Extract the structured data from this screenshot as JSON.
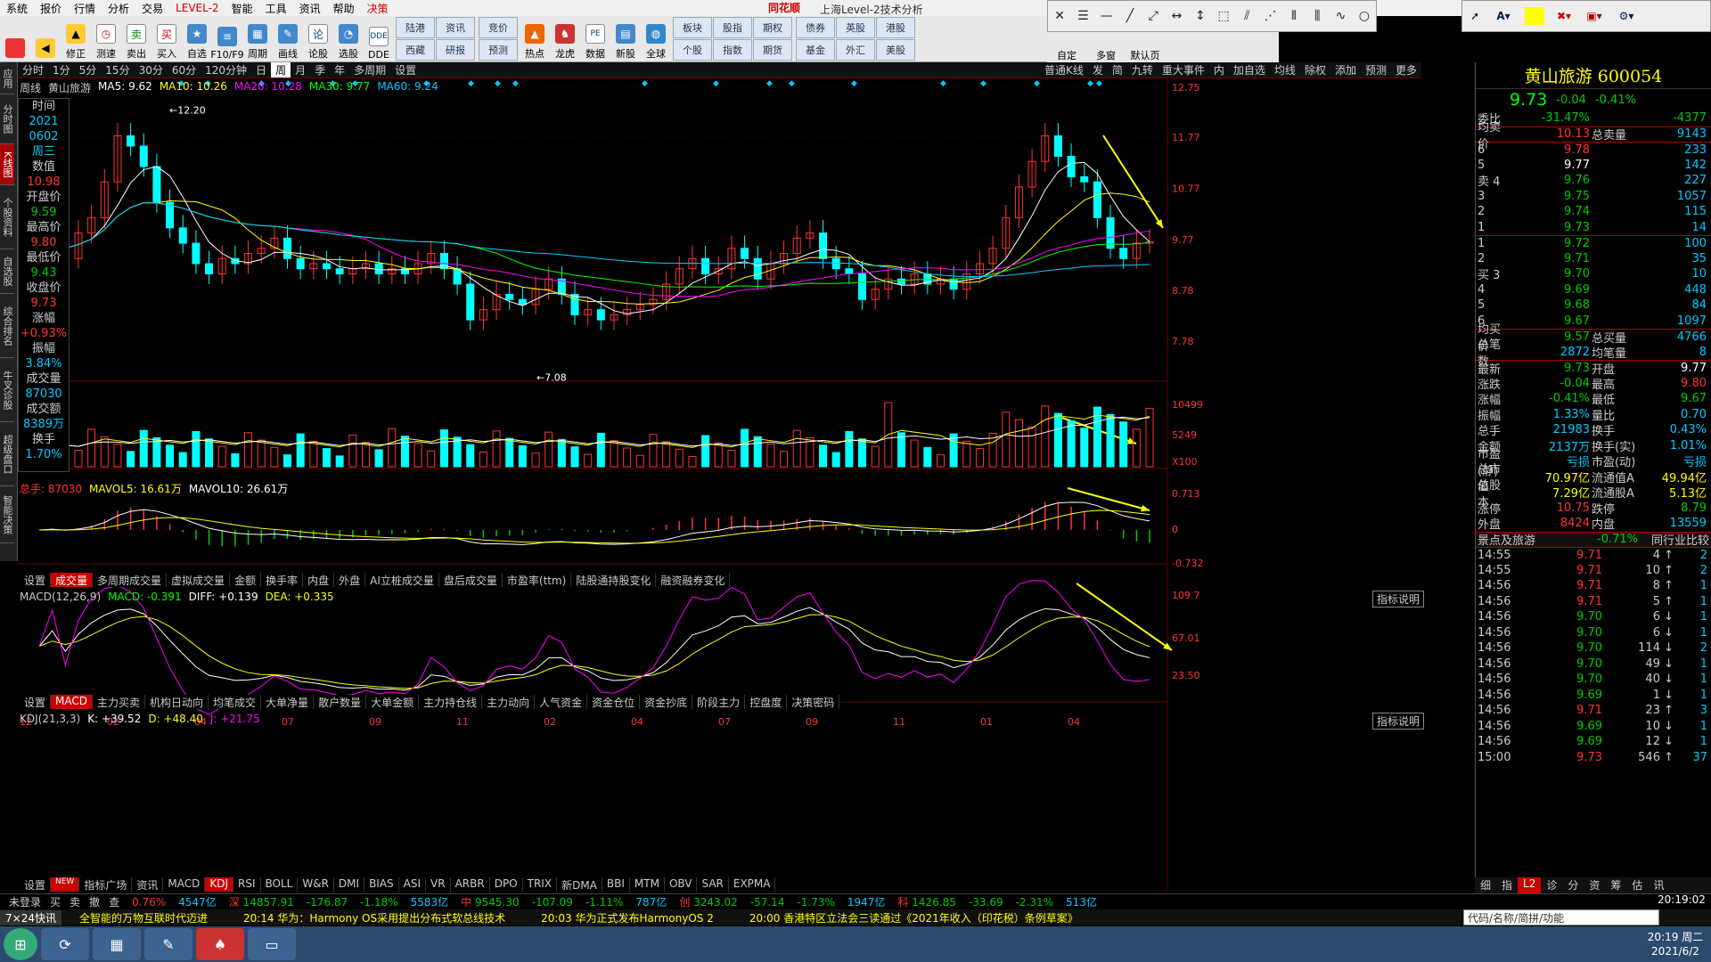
{
  "menubar": {
    "items": [
      "系统",
      "报价",
      "行情",
      "分析",
      "交易",
      "LEVEL-2",
      "智能",
      "工具",
      "资讯",
      "帮助",
      "决策"
    ],
    "brand": "同花顺",
    "title": "上海Level-2技术分析"
  },
  "toolbar": {
    "buttons": [
      [
        "后退"
      ],
      [
        "修正"
      ],
      [
        "测速"
      ],
      [
        "卖出"
      ],
      [
        "买入"
      ],
      [
        "自选"
      ],
      [
        "F10/F9"
      ],
      [
        "周期"
      ],
      [
        "画线"
      ],
      [
        "论股"
      ],
      [
        "选股"
      ],
      [
        "DDE"
      ]
    ],
    "groups": [
      [
        "陆港",
        "资讯",
        "竞价",
        "西藏",
        "研报",
        "预测"
      ],
      [
        "热点",
        "龙虎",
        "数据",
        "新股",
        "全球"
      ],
      [
        "板块",
        "股指",
        "期权",
        "债券",
        "英股",
        "港股"
      ],
      [
        "个股",
        "指数",
        "期货",
        "基金",
        "外汇",
        "美股"
      ]
    ],
    "tail": [
      "自定",
      "多窗",
      "默认页"
    ]
  },
  "leftnav": [
    "应用",
    "分时图",
    "K线图",
    "个股资料",
    "自选股",
    "综合排名",
    "牛叉诊股",
    "超级盘口",
    "智能决策"
  ],
  "periodbar": {
    "items": [
      "分时",
      "1分",
      "5分",
      "15分",
      "30分",
      "60分",
      "120分钟",
      "日",
      "周",
      "月",
      "季",
      "年",
      "多周期",
      "设置"
    ],
    "selected": "周",
    "right": [
      "普通K线",
      "发",
      "简",
      "九转",
      "重大事件",
      "内",
      "加自选",
      "均线",
      "除权",
      "添加",
      "预测",
      "更多"
    ]
  },
  "legend": {
    "name": "周线",
    "stock": "黄山旅游",
    "ma5": "MA5: 9.62",
    "ma10": "MA10: 10.26",
    "ma20": "MA20: 10.28",
    "ma30": "MA30: 9.77",
    "ma60": "MA60: 9.24"
  },
  "info": [
    [
      "时间",
      "2021"
    ],
    [
      "",
      "0602"
    ],
    [
      "",
      "周三"
    ],
    [
      "数值",
      "10.98"
    ],
    [
      "开盘价",
      "9.59"
    ],
    [
      "最高价",
      "9.80"
    ],
    [
      "最低价",
      "9.43"
    ],
    [
      "收盘价",
      "9.73"
    ],
    [
      "涨幅",
      "+0.93%"
    ],
    [
      "振幅",
      "3.84%"
    ],
    [
      "成交量",
      "87030"
    ],
    [
      "成交额",
      "8389万"
    ],
    [
      "换手",
      "1.70%"
    ]
  ],
  "axis": {
    "price": [
      "12.75",
      "11.77",
      "10.77",
      "9.77",
      "8.78",
      "7.78"
    ],
    "vol": [
      "10499",
      "5249",
      "X100"
    ],
    "macd": [
      "0.713",
      "0",
      "-0.732"
    ],
    "kdj": [
      "109.7",
      "67.01",
      "23.50"
    ],
    "months": [
      "12",
      "02",
      "04",
      "07",
      "09",
      "11",
      "02",
      "04",
      "07",
      "09",
      "11",
      "01",
      "04"
    ],
    "hi": "12.20",
    "lo": "7.08"
  },
  "volume": {
    "label": "总手: 87030",
    "mavol5": "MAVOL5: 16.61万",
    "mavol10": "MAVOL10: 26.61万"
  },
  "voltabs": [
    "设置",
    "成交量",
    "多周期成交量",
    "虚拟成交量",
    "金额",
    "换手率",
    "内盘",
    "外盘",
    "AI立桩成交量",
    "盘后成交量",
    "市盈率(ttm)",
    "陆股通持股变化",
    "融资融券变化"
  ],
  "macd": {
    "label": "MACD(12,26,9)",
    "val": "MACD: -0.391",
    "diff": "DIFF: +0.139",
    "dea": "DEA: +0.335",
    "help": "指标说明"
  },
  "macdtabs": [
    "设置",
    "MACD",
    "主力买卖",
    "机构日动向",
    "均笔成交",
    "大单净量",
    "散户数量",
    "大单金额",
    "主力持仓线",
    "主力动向",
    "人气资金",
    "资金仓位",
    "资金抄底",
    "阶段主力",
    "控盘度",
    "决策密码"
  ],
  "kdj": {
    "label": "KDJ(21,3,3)",
    "k": "K: +39.52",
    "d": "D: +48.40",
    "j": "J: +21.75",
    "help": "指标说明"
  },
  "kdjtabs": [
    "设置",
    "NEW",
    "指标广场",
    "资讯",
    "MACD",
    "KDJ",
    "RSI",
    "BOLL",
    "W&R",
    "DMI",
    "BIAS",
    "ASI",
    "VR",
    "ARBR",
    "DPO",
    "TRIX",
    "新DMA",
    "BBI",
    "MTM",
    "OBV",
    "SAR",
    "EXPMA"
  ],
  "right": {
    "title": "黄山旅游 600054",
    "price": "9.73",
    "chg": "-0.04",
    "pct": "-0.41%",
    "weibi": [
      "委比",
      "-31.47%",
      "",
      "-4377"
    ],
    "junmai": [
      "均卖价",
      "10.13",
      "总卖量",
      "9143"
    ],
    "sell": [
      [
        "6",
        "9.78",
        "233"
      ],
      [
        "5",
        "9.77",
        "142"
      ],
      [
        "4",
        "9.76",
        "227"
      ],
      [
        "3",
        "9.75",
        "1057"
      ],
      [
        "2",
        "9.74",
        "115"
      ],
      [
        "1",
        "9.73",
        "14"
      ]
    ],
    "buy": [
      [
        "1",
        "9.72",
        "100"
      ],
      [
        "2",
        "9.71",
        "35"
      ],
      [
        "3",
        "9.70",
        "10"
      ],
      [
        "4",
        "9.69",
        "448"
      ],
      [
        "5",
        "9.68",
        "84"
      ],
      [
        "6",
        "9.67",
        "1097"
      ]
    ],
    "junbuy": [
      "均买价",
      "9.57",
      "总买量",
      "4766"
    ],
    "bishu": [
      "总笔数",
      "2872",
      "均笔量",
      "8"
    ],
    "stats": [
      [
        "最新",
        "9.73",
        "开盘",
        "9.77"
      ],
      [
        "涨跌",
        "-0.04",
        "最高",
        "9.80"
      ],
      [
        "涨幅",
        "-0.41%",
        "最低",
        "9.67"
      ],
      [
        "振幅",
        "1.33%",
        "量比",
        "0.70"
      ],
      [
        "总手",
        "21983",
        "换手",
        "0.43%"
      ],
      [
        "金额",
        "2137万",
        "换手(实)",
        "1.01%"
      ],
      [
        "市盈(静)",
        "亏损",
        "市盈(动)",
        "亏损"
      ],
      [
        "总市值",
        "70.97亿",
        "流通值A",
        "49.94亿"
      ],
      [
        "总股本",
        "7.29亿",
        "流通股A",
        "5.13亿"
      ],
      [
        "涨停",
        "10.75",
        "跌停",
        "8.79"
      ],
      [
        "外盘",
        "8424",
        "内盘",
        "13559"
      ]
    ],
    "sector": [
      "景点及旅游",
      "-0.71%",
      "同行业比较"
    ],
    "ticks": [
      [
        "14:55",
        "9.71",
        "4",
        "2"
      ],
      [
        "14:55",
        "9.71",
        "10",
        "2"
      ],
      [
        "14:56",
        "9.71",
        "8",
        "1"
      ],
      [
        "14:56",
        "9.71",
        "5",
        "1"
      ],
      [
        "14:56",
        "9.70",
        "6",
        "1"
      ],
      [
        "14:56",
        "9.70",
        "6",
        "1"
      ],
      [
        "14:56",
        "9.70",
        "114",
        "2"
      ],
      [
        "14:56",
        "9.70",
        "49",
        "1"
      ],
      [
        "14:56",
        "9.70",
        "40",
        "1"
      ],
      [
        "14:56",
        "9.69",
        "1",
        "1"
      ],
      [
        "14:56",
        "9.71",
        "23",
        "3"
      ],
      [
        "14:56",
        "9.69",
        "10",
        "1"
      ],
      [
        "14:56",
        "9.69",
        "12",
        "1"
      ],
      [
        "15:00",
        "9.73",
        "546",
        "37"
      ]
    ],
    "bottomtabs": [
      "细",
      "指",
      "L2",
      "诊",
      "分",
      "资",
      "筹",
      "估",
      "讯"
    ]
  },
  "indexbar": [
    [
      "未登录",
      ""
    ],
    [
      "买",
      ""
    ],
    [
      "卖",
      ""
    ],
    [
      "撤",
      ""
    ],
    [
      "查",
      ""
    ],
    [
      "",
      "0.76%"
    ],
    [
      "",
      "4547亿"
    ],
    [
      "深",
      "14857.91"
    ],
    [
      "",
      "-176.87"
    ],
    [
      "",
      "-1.18%"
    ],
    [
      "",
      "5583亿"
    ],
    [
      "中",
      "9545.30"
    ],
    [
      "",
      "-107.09"
    ],
    [
      "",
      "-1.11%"
    ],
    [
      "",
      "787亿"
    ],
    [
      "创",
      "3243.02"
    ],
    [
      "",
      "-57.14"
    ],
    [
      "",
      "-1.73%"
    ],
    [
      "",
      "1947亿"
    ],
    [
      "科",
      "1426.85"
    ],
    [
      "",
      "-33.69"
    ],
    [
      "",
      "-2.31%"
    ],
    [
      "",
      "513亿"
    ]
  ],
  "news": [
    "7×24快讯",
    "全智能的万物互联时代迈进",
    "20:14 华为：Harmony OS采用提出分布式软总线技术",
    "20:03 华为正式发布HarmonyOS 2",
    "20:00 香港特区立法会三读通过《2021年收入（印花税）条例草案》"
  ],
  "searchbox": "代码/名称/简拼/功能",
  "clock": {
    "time": "20:19 周二",
    "date": "2021/6/2",
    "right": "20:19:02"
  }
}
